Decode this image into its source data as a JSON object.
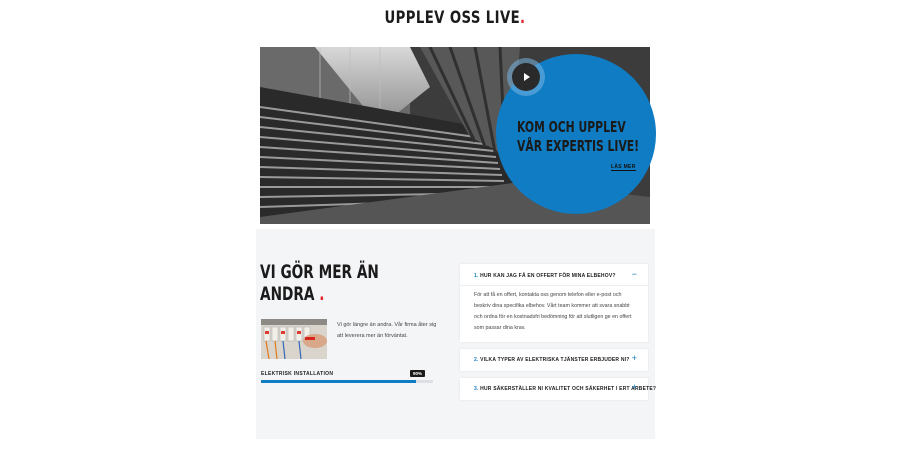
{
  "header": {
    "title": "UPPLEV OSS LIVE",
    "dot": "."
  },
  "hero": {
    "cta_title": "KOM OCH UPPLEV VÅR EXPERTIS LIVE!",
    "cta_title_line1": "KOM OCH UPPLEV",
    "cta_title_line2": "VÅR EXPERTIS LIVE!",
    "cta_link": "LÄS MER",
    "play_icon": "play-icon",
    "accent_color": "#0f7cc3"
  },
  "about": {
    "heading_line1": "VI GÖR MER ÄN",
    "heading_line2": "ANDRA",
    "heading_dot": ".",
    "intro_text": "Vi gör längre än andra. Vår firma åter sig att leverera mer än förväntat.",
    "skill": {
      "label": "ELEKTRISK INSTALLATION",
      "percent_label": "90%",
      "percent": 90
    }
  },
  "faq": [
    {
      "num": "1.",
      "question": "HUR KAN JAG FÅ EN OFFERT FÖR MINA ELBEHOV?",
      "answer": "För att få en offert, kontakta oss genom telefon eller e-post och beskriv dina specifika elbehov. Vårt team kommer att svara snabbt och ordna för en kostnadsfri bedömning för att slutligen ge en offert som passar dina krav.",
      "expanded": true,
      "toggle": "−"
    },
    {
      "num": "2.",
      "question": "VILKA TYPER AV ELEKTRISKA TJÄNSTER ERBJUDER NI?",
      "answer": "",
      "expanded": false,
      "toggle": "+"
    },
    {
      "num": "3.",
      "question": "HUR SÄKERSTÄLLER NI KVALITET OCH SÄKERHET I ERT ARBETE?",
      "answer": "",
      "expanded": false,
      "toggle": "+"
    }
  ],
  "colors": {
    "accent": "#0f7cc3",
    "red": "#e0262a",
    "dark": "#1b1b1b"
  }
}
